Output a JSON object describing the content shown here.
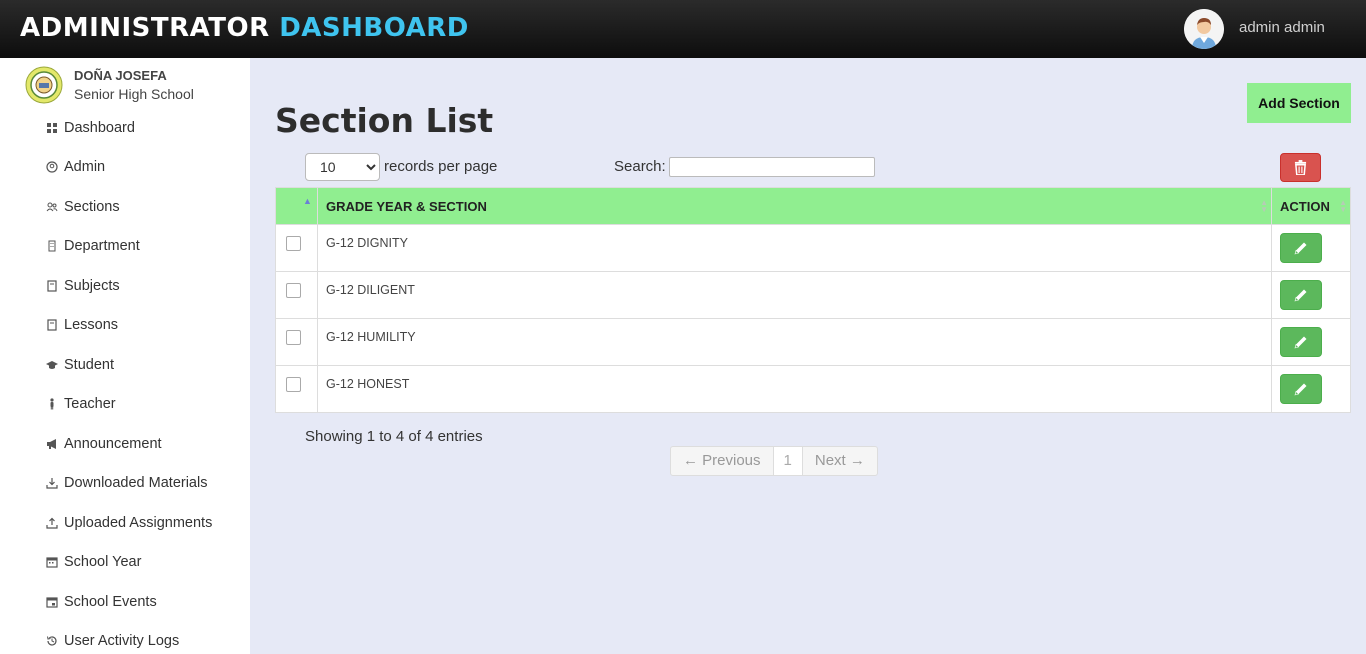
{
  "header": {
    "title_part1": "ADMINISTRATOR",
    "title_part2": "DASHBOARD",
    "user_name": "admin admin"
  },
  "sidebar": {
    "school_line1": "DOÑA JOSEFA",
    "school_line2": "Senior High School",
    "items": [
      {
        "label": "Dashboard",
        "icon": "dashboard-icon"
      },
      {
        "label": "Admin",
        "icon": "user-circle-icon"
      },
      {
        "label": "Sections",
        "icon": "users-icon"
      },
      {
        "label": "Department",
        "icon": "building-icon"
      },
      {
        "label": "Subjects",
        "icon": "book-icon"
      },
      {
        "label": "Lessons",
        "icon": "book-icon"
      },
      {
        "label": "Student",
        "icon": "graduation-cap-icon"
      },
      {
        "label": "Teacher",
        "icon": "person-icon"
      },
      {
        "label": "Announcement",
        "icon": "bullhorn-icon"
      },
      {
        "label": "Downloaded Materials",
        "icon": "download-icon"
      },
      {
        "label": "Uploaded Assignments",
        "icon": "upload-icon"
      },
      {
        "label": "School Year",
        "icon": "calendar-icon"
      },
      {
        "label": "School Events",
        "icon": "calendar-icon"
      },
      {
        "label": "User Activity Logs",
        "icon": "history-icon"
      }
    ]
  },
  "main": {
    "title": "Section List",
    "add_button": "Add Section",
    "length_value": "10",
    "length_label": "records per page",
    "search_label": "Search:",
    "columns": {
      "section": "GRADE YEAR & SECTION",
      "action": "ACTION"
    },
    "rows": [
      {
        "section": "G-12 DIGNITY"
      },
      {
        "section": "G-12 DILIGENT"
      },
      {
        "section": "G-12 HUMILITY"
      },
      {
        "section": "G-12 HONEST"
      }
    ],
    "info": "Showing 1 to 4 of 4 entries",
    "pagination": {
      "previous": "← Previous",
      "page": "1",
      "next": "Next →"
    }
  },
  "colors": {
    "header_bg": "#111111",
    "brand_accent": "#3fc4ef",
    "table_header": "#90ee90",
    "edit_button": "#5cb85c",
    "delete_button": "#d9534f",
    "content_bg": "#e6e9f6"
  }
}
